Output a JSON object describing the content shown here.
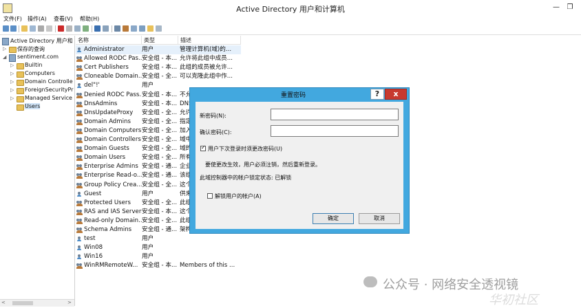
{
  "window": {
    "title": "Active Directory 用户和计算机",
    "minimize": "—",
    "restore": "❐"
  },
  "menu": [
    "文件(F)",
    "操作(A)",
    "查看(V)",
    "帮助(H)"
  ],
  "tree": {
    "root": "Active Directory 用户和",
    "items": [
      {
        "label": "保存的查询",
        "expanded": false,
        "type": "folder"
      },
      {
        "label": "sentiment.com",
        "expanded": true,
        "type": "domain"
      },
      {
        "label": "Builtin",
        "expanded": false,
        "type": "folder"
      },
      {
        "label": "Computers",
        "expanded": false,
        "type": "folder"
      },
      {
        "label": "Domain Controlle",
        "expanded": false,
        "type": "folder"
      },
      {
        "label": "ForeignSecurityPr",
        "expanded": false,
        "type": "folder"
      },
      {
        "label": "Managed Service",
        "expanded": false,
        "type": "folder"
      },
      {
        "label": "Users",
        "expanded": false,
        "type": "folder"
      }
    ],
    "scroll_left": "<",
    "scroll_right": ">"
  },
  "list": {
    "columns": [
      "名称",
      "类型",
      "描述"
    ],
    "rows": [
      {
        "name": "Administrator",
        "type": "用户",
        "desc": "管理计算机(域)的...",
        "kind": "user"
      },
      {
        "name": "Allowed RODC Pas...",
        "type": "安全组 - 本...",
        "desc": "允许将此组中成员...",
        "kind": "group"
      },
      {
        "name": "Cert Publishers",
        "type": "安全组 - 本...",
        "desc": "此组的成员被允许...",
        "kind": "group"
      },
      {
        "name": "Cloneable Domain...",
        "type": "安全组 - 全...",
        "desc": "可以克隆此组中作...",
        "kind": "group"
      },
      {
        "name": "del\"!'",
        "type": "用户",
        "desc": "",
        "kind": "user"
      },
      {
        "name": "Denied RODC Pass...",
        "type": "安全组 - 本...",
        "desc": "不允",
        "kind": "group"
      },
      {
        "name": "DnsAdmins",
        "type": "安全组 - 本...",
        "desc": "DNS",
        "kind": "group"
      },
      {
        "name": "DnsUpdateProxy",
        "type": "安全组 - 全...",
        "desc": "允许",
        "kind": "group"
      },
      {
        "name": "Domain Admins",
        "type": "安全组 - 全...",
        "desc": "指定",
        "kind": "group"
      },
      {
        "name": "Domain Computers",
        "type": "安全组 - 全...",
        "desc": "加入",
        "kind": "group"
      },
      {
        "name": "Domain Controllers",
        "type": "安全组 - 全...",
        "desc": "域中",
        "kind": "group"
      },
      {
        "name": "Domain Guests",
        "type": "安全组 - 全...",
        "desc": "域的",
        "kind": "group"
      },
      {
        "name": "Domain Users",
        "type": "安全组 - 全...",
        "desc": "所有",
        "kind": "group"
      },
      {
        "name": "Enterprise Admins",
        "type": "安全组 - 通...",
        "desc": "企业",
        "kind": "group"
      },
      {
        "name": "Enterprise Read-o...",
        "type": "安全组 - 通...",
        "desc": "该组",
        "kind": "group"
      },
      {
        "name": "Group Policy Crea...",
        "type": "安全组 - 全...",
        "desc": "这个",
        "kind": "group"
      },
      {
        "name": "Guest",
        "type": "用户",
        "desc": "供来",
        "kind": "user"
      },
      {
        "name": "Protected Users",
        "type": "安全组 - 全...",
        "desc": "此组",
        "kind": "group"
      },
      {
        "name": "RAS and IAS Servers",
        "type": "安全组 - 本...",
        "desc": "这个",
        "kind": "group"
      },
      {
        "name": "Read-only Domain...",
        "type": "安全组 - 全...",
        "desc": "此组",
        "kind": "group"
      },
      {
        "name": "Schema Admins",
        "type": "安全组 - 通...",
        "desc": "架构",
        "kind": "group"
      },
      {
        "name": "test",
        "type": "用户",
        "desc": "",
        "kind": "user"
      },
      {
        "name": "Win08",
        "type": "用户",
        "desc": "",
        "kind": "user"
      },
      {
        "name": "Win16",
        "type": "用户",
        "desc": "",
        "kind": "user"
      },
      {
        "name": "WinRMRemoteW...",
        "type": "安全组 - 本...",
        "desc": "Members of this ...",
        "kind": "group"
      }
    ]
  },
  "dialog": {
    "title": "重置密码",
    "help": "?",
    "close": "x",
    "new_password_label": "新密码(N):",
    "confirm_password_label": "确认密码(C):",
    "new_password_value": "",
    "confirm_password_value": "",
    "must_change_label": "用户下次登录时须更改密码(U)",
    "must_change_checked": true,
    "info_text": "要使更改生效，用户必须注销，然后重新登录。",
    "lockout_text": "此域控制器中的帐户锁定状态: 已解锁",
    "unlock_label": "解锁用户的帐户(A)",
    "unlock_checked": false,
    "ok_label": "确定",
    "cancel_label": "取消"
  },
  "watermark": {
    "text": "公众号 · 网络安全透视镜",
    "text2": "华初社区"
  }
}
